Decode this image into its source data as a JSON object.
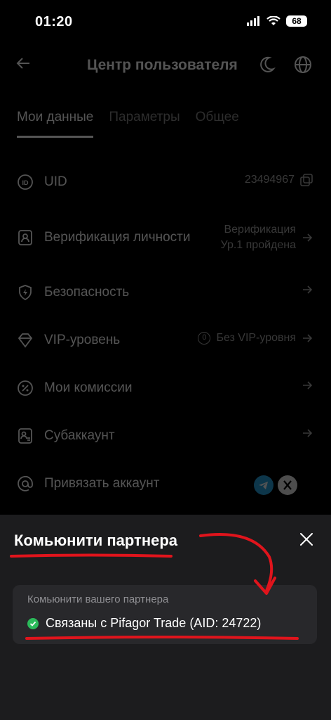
{
  "status_bar": {
    "time": "01:20",
    "battery": "68"
  },
  "header": {
    "title": "Центр пользователя"
  },
  "tabs": [
    {
      "label": "Мои данные",
      "active": true
    },
    {
      "label": "Параметры",
      "active": false
    },
    {
      "label": "Общее",
      "active": false
    }
  ],
  "rows": {
    "uid": {
      "label": "UID",
      "value": "23494967"
    },
    "verification": {
      "label": "Верификация личности",
      "value_line1": "Верификация",
      "value_line2": "Ур.1 пройдена"
    },
    "security": {
      "label": "Безопасность"
    },
    "vip": {
      "label": "VIP-уровень",
      "badge": "0",
      "value": "Без VIP-уровня"
    },
    "commissions": {
      "label": "Мои комиссии"
    },
    "subaccount": {
      "label": "Субаккаунт"
    },
    "link_account": {
      "label": "Привязать аккаунт"
    }
  },
  "sheet": {
    "title": "Комьюнити партнера",
    "card_label": "Комьюнити вашего партнера",
    "status": "Связаны с Pifagor Trade (AID: 24722)"
  },
  "colors": {
    "accent_red": "#e0141c",
    "success_green": "#2bba5a",
    "telegram_blue": "#2aa3e0"
  }
}
